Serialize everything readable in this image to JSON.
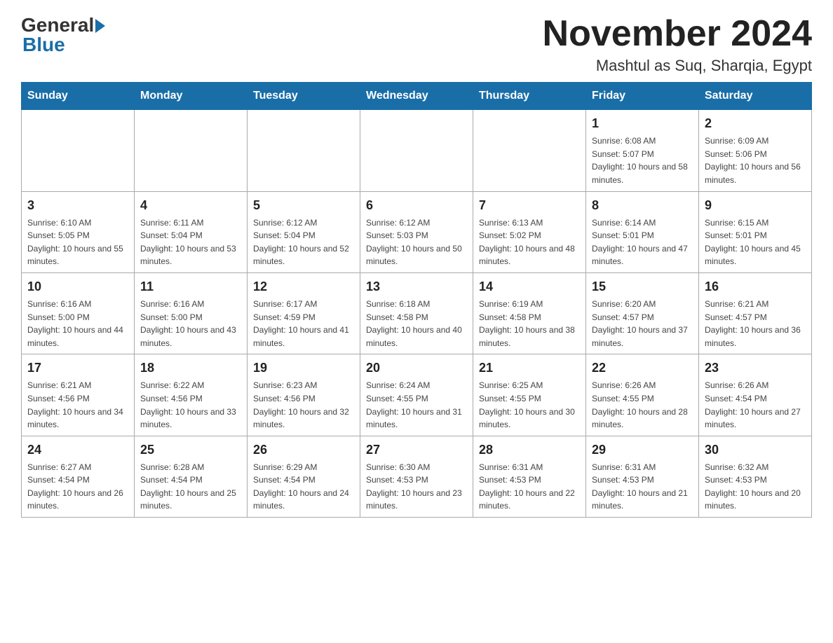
{
  "logo": {
    "general": "General",
    "blue": "Blue"
  },
  "header": {
    "title": "November 2024",
    "subtitle": "Mashtul as Suq, Sharqia, Egypt"
  },
  "weekdays": [
    "Sunday",
    "Monday",
    "Tuesday",
    "Wednesday",
    "Thursday",
    "Friday",
    "Saturday"
  ],
  "weeks": [
    [
      {
        "day": "",
        "info": ""
      },
      {
        "day": "",
        "info": ""
      },
      {
        "day": "",
        "info": ""
      },
      {
        "day": "",
        "info": ""
      },
      {
        "day": "",
        "info": ""
      },
      {
        "day": "1",
        "info": "Sunrise: 6:08 AM\nSunset: 5:07 PM\nDaylight: 10 hours and 58 minutes."
      },
      {
        "day": "2",
        "info": "Sunrise: 6:09 AM\nSunset: 5:06 PM\nDaylight: 10 hours and 56 minutes."
      }
    ],
    [
      {
        "day": "3",
        "info": "Sunrise: 6:10 AM\nSunset: 5:05 PM\nDaylight: 10 hours and 55 minutes."
      },
      {
        "day": "4",
        "info": "Sunrise: 6:11 AM\nSunset: 5:04 PM\nDaylight: 10 hours and 53 minutes."
      },
      {
        "day": "5",
        "info": "Sunrise: 6:12 AM\nSunset: 5:04 PM\nDaylight: 10 hours and 52 minutes."
      },
      {
        "day": "6",
        "info": "Sunrise: 6:12 AM\nSunset: 5:03 PM\nDaylight: 10 hours and 50 minutes."
      },
      {
        "day": "7",
        "info": "Sunrise: 6:13 AM\nSunset: 5:02 PM\nDaylight: 10 hours and 48 minutes."
      },
      {
        "day": "8",
        "info": "Sunrise: 6:14 AM\nSunset: 5:01 PM\nDaylight: 10 hours and 47 minutes."
      },
      {
        "day": "9",
        "info": "Sunrise: 6:15 AM\nSunset: 5:01 PM\nDaylight: 10 hours and 45 minutes."
      }
    ],
    [
      {
        "day": "10",
        "info": "Sunrise: 6:16 AM\nSunset: 5:00 PM\nDaylight: 10 hours and 44 minutes."
      },
      {
        "day": "11",
        "info": "Sunrise: 6:16 AM\nSunset: 5:00 PM\nDaylight: 10 hours and 43 minutes."
      },
      {
        "day": "12",
        "info": "Sunrise: 6:17 AM\nSunset: 4:59 PM\nDaylight: 10 hours and 41 minutes."
      },
      {
        "day": "13",
        "info": "Sunrise: 6:18 AM\nSunset: 4:58 PM\nDaylight: 10 hours and 40 minutes."
      },
      {
        "day": "14",
        "info": "Sunrise: 6:19 AM\nSunset: 4:58 PM\nDaylight: 10 hours and 38 minutes."
      },
      {
        "day": "15",
        "info": "Sunrise: 6:20 AM\nSunset: 4:57 PM\nDaylight: 10 hours and 37 minutes."
      },
      {
        "day": "16",
        "info": "Sunrise: 6:21 AM\nSunset: 4:57 PM\nDaylight: 10 hours and 36 minutes."
      }
    ],
    [
      {
        "day": "17",
        "info": "Sunrise: 6:21 AM\nSunset: 4:56 PM\nDaylight: 10 hours and 34 minutes."
      },
      {
        "day": "18",
        "info": "Sunrise: 6:22 AM\nSunset: 4:56 PM\nDaylight: 10 hours and 33 minutes."
      },
      {
        "day": "19",
        "info": "Sunrise: 6:23 AM\nSunset: 4:56 PM\nDaylight: 10 hours and 32 minutes."
      },
      {
        "day": "20",
        "info": "Sunrise: 6:24 AM\nSunset: 4:55 PM\nDaylight: 10 hours and 31 minutes."
      },
      {
        "day": "21",
        "info": "Sunrise: 6:25 AM\nSunset: 4:55 PM\nDaylight: 10 hours and 30 minutes."
      },
      {
        "day": "22",
        "info": "Sunrise: 6:26 AM\nSunset: 4:55 PM\nDaylight: 10 hours and 28 minutes."
      },
      {
        "day": "23",
        "info": "Sunrise: 6:26 AM\nSunset: 4:54 PM\nDaylight: 10 hours and 27 minutes."
      }
    ],
    [
      {
        "day": "24",
        "info": "Sunrise: 6:27 AM\nSunset: 4:54 PM\nDaylight: 10 hours and 26 minutes."
      },
      {
        "day": "25",
        "info": "Sunrise: 6:28 AM\nSunset: 4:54 PM\nDaylight: 10 hours and 25 minutes."
      },
      {
        "day": "26",
        "info": "Sunrise: 6:29 AM\nSunset: 4:54 PM\nDaylight: 10 hours and 24 minutes."
      },
      {
        "day": "27",
        "info": "Sunrise: 6:30 AM\nSunset: 4:53 PM\nDaylight: 10 hours and 23 minutes."
      },
      {
        "day": "28",
        "info": "Sunrise: 6:31 AM\nSunset: 4:53 PM\nDaylight: 10 hours and 22 minutes."
      },
      {
        "day": "29",
        "info": "Sunrise: 6:31 AM\nSunset: 4:53 PM\nDaylight: 10 hours and 21 minutes."
      },
      {
        "day": "30",
        "info": "Sunrise: 6:32 AM\nSunset: 4:53 PM\nDaylight: 10 hours and 20 minutes."
      }
    ]
  ]
}
